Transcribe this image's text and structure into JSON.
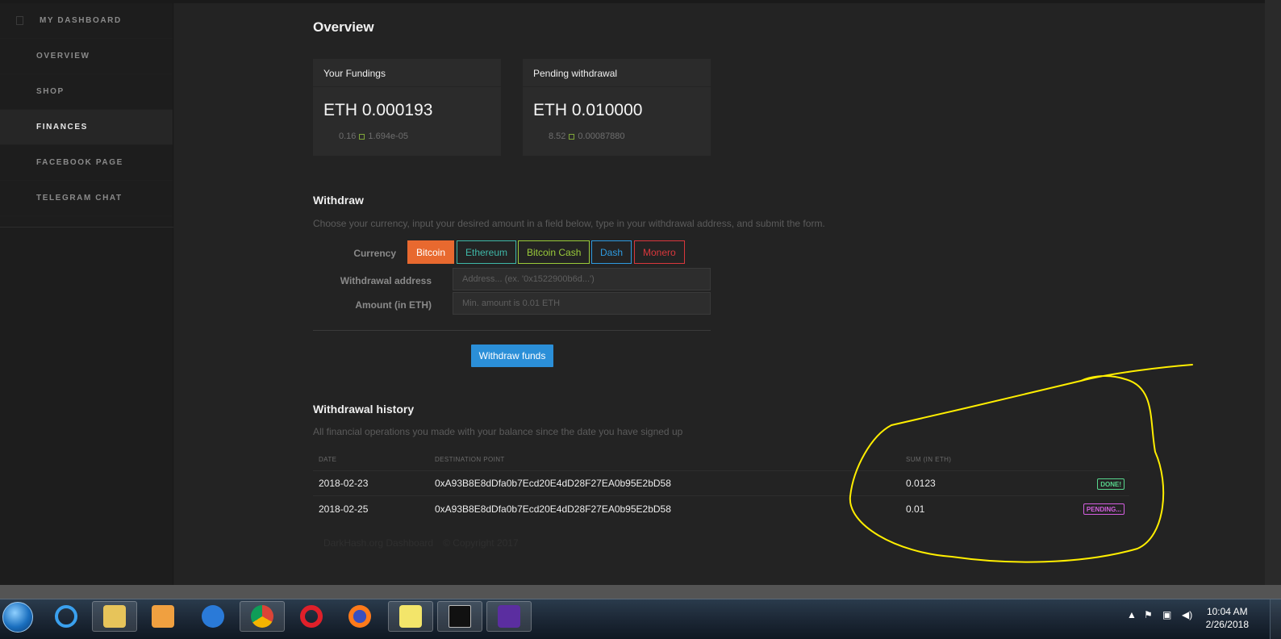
{
  "sidebar": {
    "items": [
      {
        "label": "MY DASHBOARD"
      },
      {
        "label": "OVERVIEW"
      },
      {
        "label": "SHOP"
      },
      {
        "label": "FINANCES"
      },
      {
        "label": "FACEBOOK PAGE"
      },
      {
        "label": "TELEGRAM CHAT"
      }
    ],
    "active": "FINANCES"
  },
  "page": {
    "title": "Overview"
  },
  "cards": [
    {
      "title": "Your Fundings",
      "value": "ETH 0.000193",
      "sub_left": "0.16",
      "sub_right": "1.694e-05"
    },
    {
      "title": "Pending withdrawal",
      "value": "ETH 0.010000",
      "sub_left": "8.52",
      "sub_right": "0.00087880"
    }
  ],
  "withdraw": {
    "title": "Withdraw",
    "description": "Choose your currency, input your desired amount in a field below, type in your withdrawal address, and submit the form.",
    "currency_label": "Currency",
    "currencies": [
      {
        "label": "Bitcoin",
        "color": "#e8692f",
        "selected": true
      },
      {
        "label": "Ethereum",
        "color": "#3fb8a8",
        "selected": false
      },
      {
        "label": "Bitcoin Cash",
        "color": "#9acb3a",
        "selected": false
      },
      {
        "label": "Dash",
        "color": "#2e9be0",
        "selected": false
      },
      {
        "label": "Monero",
        "color": "#d9373c",
        "selected": false
      }
    ],
    "address_label": "Withdrawal address",
    "address_placeholder": "Address... (ex. '0x1522900b6d...')",
    "amount_label": "Amount (in ETH)",
    "amount_placeholder": "Min. amount is 0.01 ETH",
    "submit_label": "Withdraw funds"
  },
  "history": {
    "title": "Withdrawal history",
    "description": "All financial operations you made with your balance since the date you have signed up",
    "columns": [
      "DATE",
      "DESTINATION POINT",
      "SUM (IN ETH)"
    ],
    "rows": [
      {
        "date": "2018-02-23",
        "destination": "0xA93B8E8dDfa0b7Ecd20E4dD28F27EA0b95E2bD58",
        "sum": "0.0123",
        "status": "DONE!"
      },
      {
        "date": "2018-02-25",
        "destination": "0xA93B8E8dDfa0b7Ecd20E4dD28F27EA0b95E2bD58",
        "sum": "0.01",
        "status": "PENDING..."
      }
    ]
  },
  "footer": {
    "left": "DarkHash.org Dashboard",
    "right": "© Copyright 2017"
  },
  "colors": {
    "accent": "#e8692f",
    "button": "#2b8fd8",
    "annotation": "#ffee00",
    "done": "#58d68d",
    "pending": "#d45fe0"
  },
  "taskbar": {
    "apps": [
      "start-orb",
      "internet-explorer",
      "file-explorer",
      "media-player",
      "app-blue-arrow",
      "chrome",
      "opera",
      "firefox",
      "sticky-notes",
      "command-prompt",
      "app-chip"
    ],
    "time": "10:04 AM",
    "date": "2/26/2018"
  }
}
